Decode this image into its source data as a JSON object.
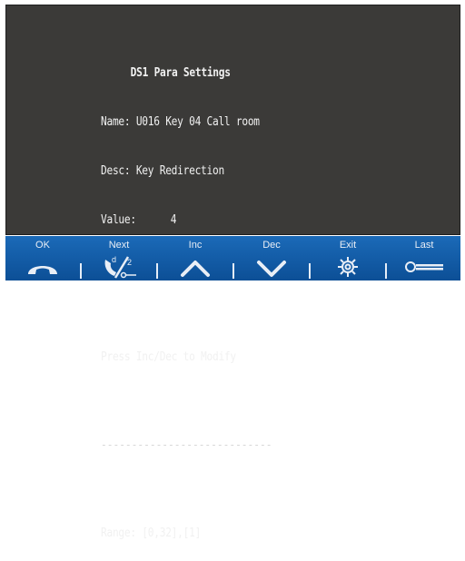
{
  "screen": {
    "title": "DS1 Para Settings",
    "name_line": "Name: U016 Key 04 Call room",
    "desc_line": "Desc: Key Redirection",
    "value_label": "Value:",
    "value": "4",
    "separator": "----------------------------",
    "instruction": "Press Inc/Dec to Modify",
    "range_line": "Range: [0,32],[1]"
  },
  "softkeys": [
    {
      "label": "OK",
      "icon": "handset-icon"
    },
    {
      "label": "Next",
      "icon": "redirect-icon"
    },
    {
      "label": "Inc",
      "icon": "chevron-up-icon"
    },
    {
      "label": "Dec",
      "icon": "chevron-down-icon"
    },
    {
      "label": "Exit",
      "icon": "gear-icon"
    },
    {
      "label": "Last",
      "icon": "key-icon"
    }
  ],
  "colors": {
    "screen_bg": "#3b3a38",
    "screen_text": "#f1f1f1",
    "bar_bg": "#1560ad",
    "icon_color": "#e9eef6"
  }
}
